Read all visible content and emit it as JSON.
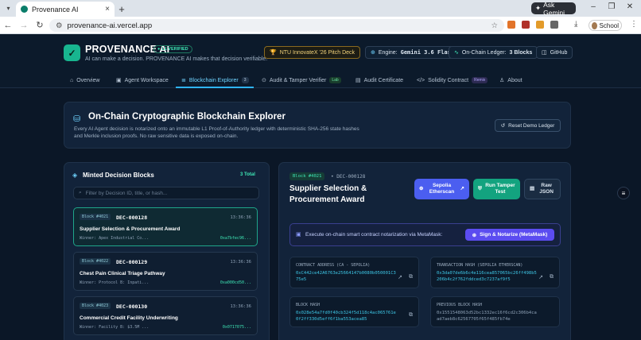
{
  "browser": {
    "tab_title": "Provenance AI",
    "url": "provenance-ai.vercel.app",
    "ask_gemini": "Ask Gemini",
    "profile": "School"
  },
  "app": {
    "name": "PROVENANCE AI",
    "verified": "L1 VERIFIED",
    "tagline": "AI can make a decision. PROVENANCE AI makes that decision verifiable.",
    "pills": {
      "ntu": "NTU InnovateX '26 Pitch Deck",
      "engine_label": "Engine:",
      "engine_value": "Gemini 3.6 Flash",
      "ledger_label": "On-Chain Ledger:",
      "ledger_value": "3 Blocks",
      "github": "GitHub"
    }
  },
  "nav": {
    "overview": "Overview",
    "workspace": "Agent Workspace",
    "explorer": "Blockchain Explorer",
    "explorer_badge": "3",
    "audit": "Audit & Tamper Verifier",
    "audit_badge": "Lab",
    "certificate": "Audit Certificate",
    "solidity": "Solidity Contract",
    "solidity_badge": "Remix",
    "about": "About"
  },
  "hero": {
    "title": "On-Chain Cryptographic Blockchain Explorer",
    "description": "Every AI Agent decision is notarized onto an immutable L1 Proof-of-Authority ledger with deterministic SHA-256 state hashes and Merkle inclusion proofs. No raw sensitive data is exposed on-chain.",
    "reset": "Reset Demo Ledger"
  },
  "minted": {
    "title": "Minted Decision Blocks",
    "count": "3 Total",
    "search_placeholder": "Filter by Decision ID, title, or hash...",
    "blocks": [
      {
        "block": "Block #4021",
        "id": "DEC-000128",
        "time": "13:36:36",
        "title": "Supplier Selection & Procurement Award",
        "winner": "Winner: Apex Industrial Co...",
        "hash": "0xa7bfec96..."
      },
      {
        "block": "Block #4022",
        "id": "DEC-000129",
        "time": "13:36:36",
        "title": "Chest Pain Clinical Triage Pathway",
        "winner": "Winner: Protocol B: Inpati...",
        "hash": "0xa000cd50..."
      },
      {
        "block": "Block #4023",
        "id": "DEC-000130",
        "time": "13:36:36",
        "title": "Commercial Credit Facility Underwriting",
        "winner": "Winner: Facility B: $3.5M ...",
        "hash": "0x0717075..."
      }
    ]
  },
  "detail": {
    "block": "Block #4021",
    "id": "DEC-000128",
    "title": "Supplier Selection & Procurement Award",
    "btn_etherscan": "Sepolia Etherscan",
    "btn_tamper": "Run Tamper Test",
    "btn_raw": "Raw JSON",
    "notarize_text": "Execute on-chain smart contract notarization via MetaMask:",
    "notarize_btn": "Sign & Notarize (MetaMask)",
    "contract_label": "CONTRACT ADDRESS (CA - SEPOLIA)",
    "contract_value": "0xC442ce42A6763e25664147b0080b050001C375e5",
    "tx_label": "TRANSACTION HASH (SEPOLIA ETHERSCAN)",
    "tx_value": "0x3da07de6b6c4e116cea857065bc26ff498b5206b4c2f762fddced3c7237af9f5",
    "bh_label": "BLOCK HASH",
    "bh_value": "0x028e54a7fd0f40cb324f5d118c4ac065761e0f2ff330d5eff6f1ba553acea85",
    "prev_label": "PREVIOUS BLOCK HASH",
    "prev_value": "0x1551548063d52bc1332ec16f6cd2c306b4caad7aeb8c62567705f65f485fb74e"
  }
}
